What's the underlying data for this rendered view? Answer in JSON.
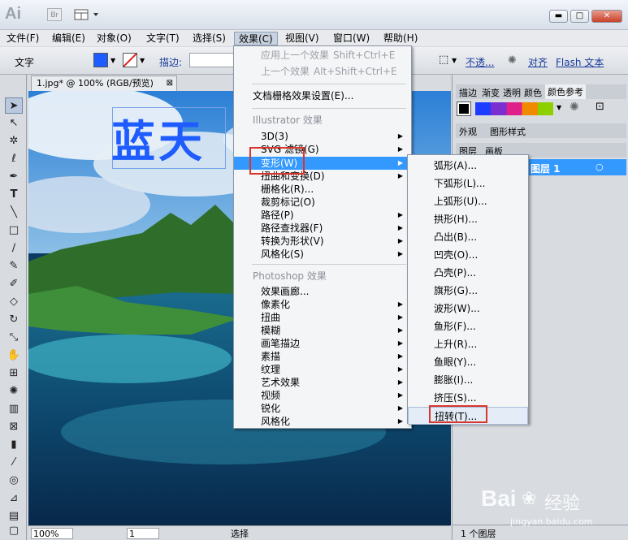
{
  "app": {
    "logo": "Ai",
    "bridge": "Br"
  },
  "window_buttons": {
    "minimize": "▬",
    "maximize": "□",
    "close": "✕"
  },
  "menubar": [
    "文件(F)",
    "编辑(E)",
    "对象(O)",
    "文字(T)",
    "选择(S)",
    "效果(C)",
    "视图(V)",
    "窗口(W)",
    "帮助(H)"
  ],
  "control": {
    "label": "文字",
    "stroke_label": "描边:",
    "opacity": "不透...",
    "align": "对齐",
    "flash": "Flash 文本",
    "fill_color": "#1e5cff"
  },
  "document": {
    "tab": "1.jpg* @ 100% (RGB/预览)",
    "canvas_text": "蓝天"
  },
  "status": {
    "zoom": "100%",
    "page": "1",
    "mode": "选择"
  },
  "effect_menu": {
    "items": [
      {
        "label": "应用上一个效果",
        "shortcut": "Shift+Ctrl+E",
        "disabled": true
      },
      {
        "label": "上一个效果",
        "shortcut": "Alt+Shift+Ctrl+E",
        "disabled": true
      },
      {
        "label": "文档栅格效果设置(E)..."
      },
      {
        "label": "Illustrator 效果"
      },
      {
        "label": "3D(3)"
      },
      {
        "label": "SVG 滤镜(G)"
      },
      {
        "label": "变形(W)"
      },
      {
        "label": "扭曲和变换(D)"
      },
      {
        "label": "栅格化(R)..."
      },
      {
        "label": "裁剪标记(O)"
      },
      {
        "label": "路径(P)"
      },
      {
        "label": "路径查找器(F)"
      },
      {
        "label": "转换为形状(V)"
      },
      {
        "label": "风格化(S)"
      },
      {
        "label": "Photoshop 效果"
      },
      {
        "label": "效果画廊..."
      },
      {
        "label": "像素化"
      },
      {
        "label": "扭曲"
      },
      {
        "label": "模糊"
      },
      {
        "label": "画笔描边"
      },
      {
        "label": "素描"
      },
      {
        "label": "纹理"
      },
      {
        "label": "艺术效果"
      },
      {
        "label": "视频"
      },
      {
        "label": "锐化"
      },
      {
        "label": "风格化"
      }
    ]
  },
  "warp_menu": {
    "items": [
      "弧形(A)...",
      "下弧形(L)...",
      "上弧形(U)...",
      "拱形(H)...",
      "凸出(B)...",
      "凹壳(O)...",
      "凸壳(P)...",
      "旗形(G)...",
      "波形(W)...",
      "鱼形(F)...",
      "上升(R)...",
      "鱼眼(Y)...",
      "膨胀(I)...",
      "挤压(S)...",
      "扭转(T)..."
    ]
  },
  "panels": {
    "tabs1": [
      "描边",
      "渐变",
      "透明",
      "颜色",
      "颜色参考"
    ],
    "tabs2": [
      "外观",
      "图形样式"
    ],
    "tabs3": [
      "图层",
      "画板"
    ],
    "layer_name": "图层 1",
    "footer": "1 个图层"
  },
  "watermark": {
    "brand": "Bai",
    "brand2": "经验",
    "url": "jingyan.baidu.com"
  }
}
